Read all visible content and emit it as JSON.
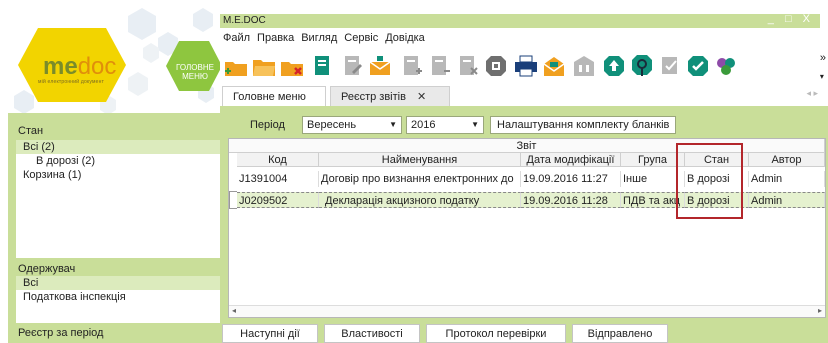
{
  "window": {
    "title": "M.E.DOC",
    "controls": "_ □ X"
  },
  "logo": {
    "me": "me",
    "doc": "doc",
    "subtitle": "мій електронний документ"
  },
  "home": {
    "label_line1": "ГОЛОВНЕ",
    "label_line2": "МЕНЮ"
  },
  "menu": [
    "Файл",
    "Правка",
    "Вигляд",
    "Сервіс",
    "Довідка"
  ],
  "toolbar": {
    "more": "»"
  },
  "tabs": {
    "main": "Головне меню",
    "registry": "Реєстр звітів",
    "close": "✕",
    "nav": "◂ ▸"
  },
  "left": {
    "state": {
      "title": "Стан",
      "items": [
        "Всі (2)",
        "В дорозі (2)",
        "Корзина (1)"
      ]
    },
    "recipient": {
      "title": "Одержувач",
      "items": [
        "Всі",
        "Податкова інспекція"
      ]
    },
    "period_registry": {
      "title": "Реєстр за період"
    }
  },
  "filters": {
    "period_label": "Період",
    "month": "Вересень",
    "year": "2016",
    "blanks_button": "Налаштування комплекту бланків",
    "arrow": "▼"
  },
  "grid": {
    "group_header": "Звіт",
    "columns": [
      "Код",
      "Найменування",
      "Дата модифікації",
      "Група",
      "Стан",
      "Автор"
    ],
    "rows": [
      [
        "J1391004",
        "Договір про визнання електронних до",
        "19.09.2016 11:27",
        "Інше",
        "В дорозі",
        "Admin"
      ],
      [
        "J0209502",
        "Декларація акцизного податку",
        "19.09.2016 11:28",
        "ПДВ та акц",
        "В дорозі",
        "Admin"
      ]
    ],
    "scroll_left": "◂",
    "scroll_right": "▸"
  },
  "bottom_buttons": [
    "Наступні дії",
    "Властивості",
    "Протокол перевірки",
    "Відправлено"
  ],
  "colors": {
    "panel_green": "#c9de99",
    "accent_red": "#b3262b",
    "icon_orange": "#f0a020",
    "icon_teal": "#10907a"
  }
}
